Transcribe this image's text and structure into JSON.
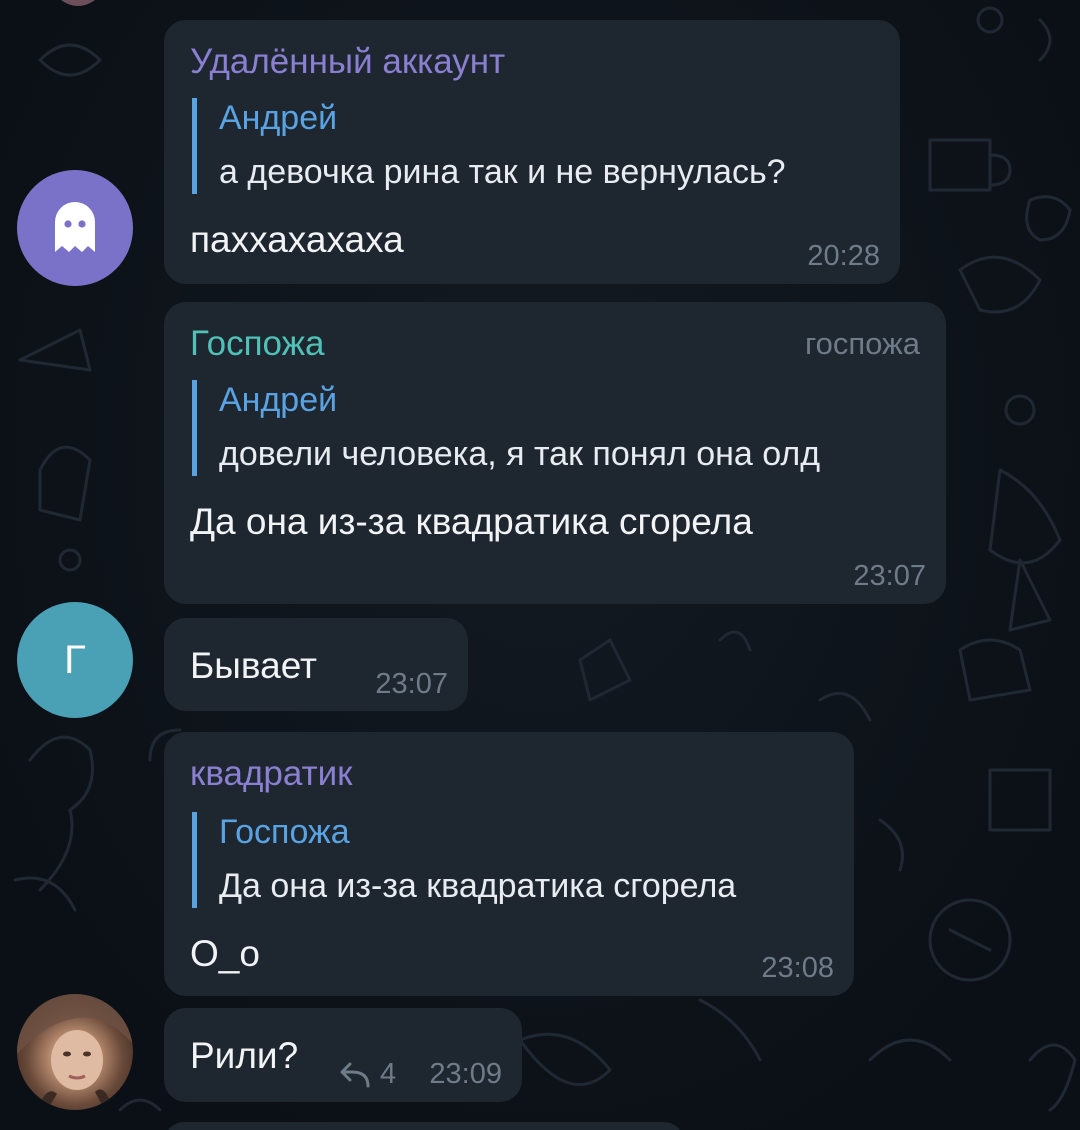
{
  "colors": {
    "background": "#0d1219",
    "bubble": "#1e2630",
    "reply_accent": "#5aa3e3",
    "time": "#6e7b88",
    "sender_deleted": "#8a7fd0",
    "sender_gospozha": "#4fc1b7",
    "sender_kvadratik": "#8a7fd0",
    "avatar_ghost": "#7a72c8",
    "avatar_g": "#4aa0b4"
  },
  "messages": [
    {
      "sender": "Удалённый аккаунт",
      "avatar_icon": "ghost-icon",
      "reply": {
        "author": "Андрей",
        "text": "а девочка рина так и не вернулась?"
      },
      "text": "паххахахаха",
      "time": "20:28"
    },
    {
      "sender": "Госпожа",
      "role": "госпожа",
      "reply": {
        "author": "Андрей",
        "text": "довели человека, я так понял она олд"
      },
      "text": "Да она из-за квадратика сгорела",
      "time": "23:07"
    },
    {
      "avatar_letter": "Г",
      "text": "Бывает",
      "time": "23:07"
    },
    {
      "sender": "квадратик",
      "reply": {
        "author": "Госпожа",
        "text": "Да она из-за квадратика сгорела"
      },
      "text": "О_о",
      "time": "23:08"
    },
    {
      "avatar_icon": "user-photo",
      "text": "Рили?",
      "replies_icon": "reply-arrow-icon",
      "replies_count": "4",
      "time": "23:09"
    }
  ]
}
